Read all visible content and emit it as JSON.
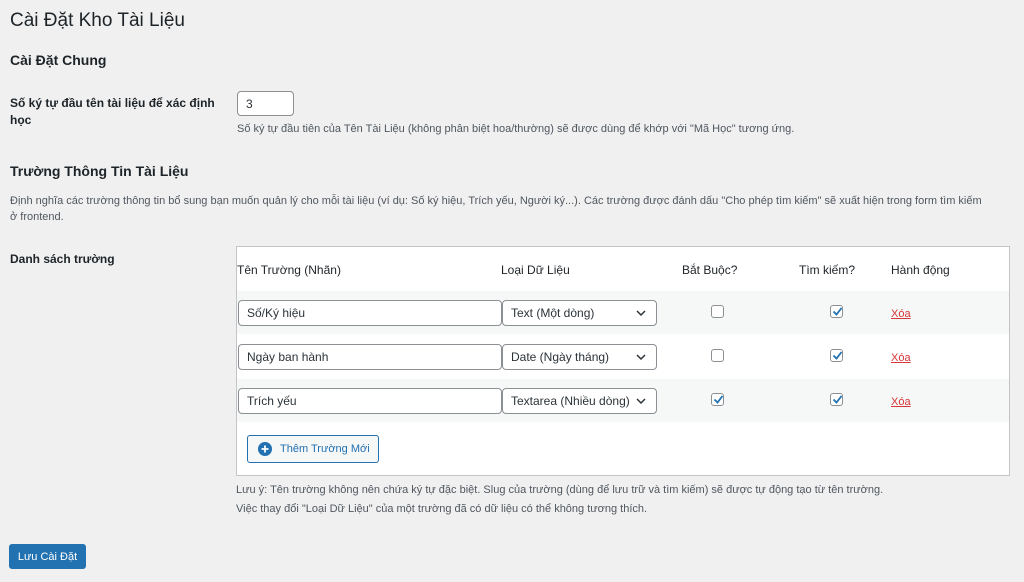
{
  "page": {
    "title": "Cài Đặt Kho Tài Liệu"
  },
  "general": {
    "heading": "Cài Đặt Chung",
    "prefix_label": "Số ký tự đầu tên tài liệu để xác định học",
    "prefix_value": "3",
    "prefix_desc": "Số ký tự đầu tiên của Tên Tài Liệu (không phân biệt hoa/thường) sẽ được dùng để khớp với \"Mã Học\" tương ứng."
  },
  "fields": {
    "heading": "Trường Thông Tin Tài Liệu",
    "desc_line1": "Định nghĩa các trường thông tin bổ sung bạn muốn quản lý cho mỗi tài liệu (ví dụ: Số ký hiệu, Trích yếu, Người ký...). Các trường được đánh dấu \"Cho phép tìm kiếm\" sẽ xuất hiện trong form tìm kiếm",
    "desc_line2": "ở frontend.",
    "list_label": "Danh sách trường",
    "columns": {
      "name": "Tên Trường (Nhãn)",
      "type": "Loại Dữ Liệu",
      "required": "Bắt Buộc?",
      "search": "Tìm kiếm?",
      "action": "Hành động"
    },
    "rows": [
      {
        "name": "Số/Ký hiệu",
        "type": "Text (Một dòng)",
        "required": false,
        "searchable": true,
        "action": "Xóa"
      },
      {
        "name": "Ngày ban hành",
        "type": "Date (Ngày tháng)",
        "required": false,
        "searchable": true,
        "action": "Xóa"
      },
      {
        "name": "Trích yếu",
        "type": "Textarea (Nhiều dòng)",
        "required": true,
        "searchable": true,
        "action": "Xóa"
      }
    ],
    "add_button": "Thêm Trường Mới",
    "note_line1": "Lưu ý: Tên trường không nên chứa ký tự đặc biệt. Slug của trường (dùng để lưu trữ và tìm kiếm) sẽ được tự động tạo từ tên trường.",
    "note_line2": "Việc thay đổi \"Loại Dữ Liệu\" của một trường đã có dữ liệu có thể không tương thích."
  },
  "save_button": "Lưu Cài Đặt",
  "icons": {
    "select": "chevron-down-icon",
    "check": "checkmark-icon",
    "add": "plus-circle-icon"
  },
  "colors": {
    "primary": "#2271b1",
    "danger": "#d63638",
    "background": "#f0f0f1"
  }
}
